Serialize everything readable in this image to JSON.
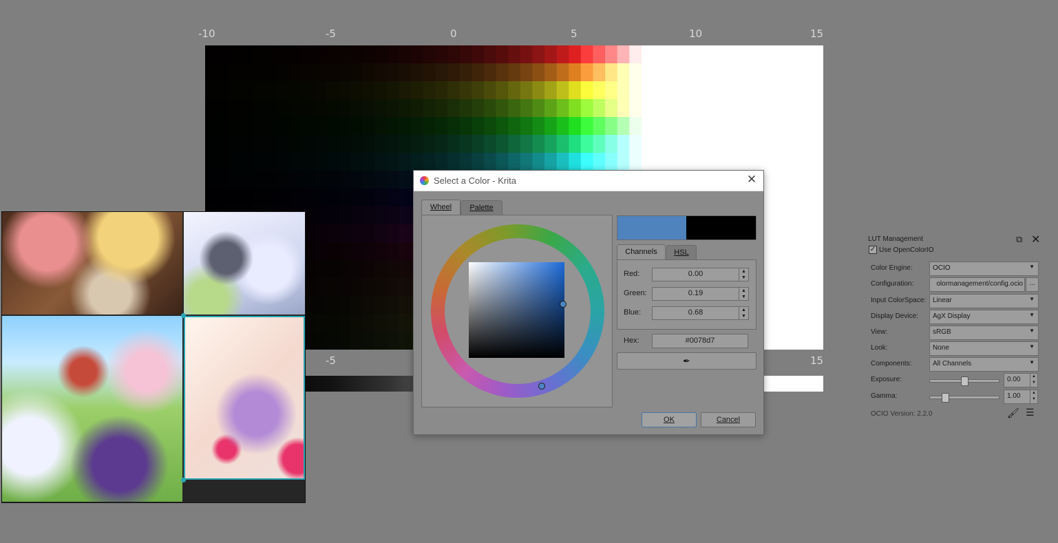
{
  "ruler_top": [
    "-10",
    "-5",
    "0",
    "5",
    "10",
    "15"
  ],
  "ruler_bottom": [
    "-5",
    "15"
  ],
  "dialog": {
    "title": "Select a Color - Krita",
    "tabs": [
      "Wheel",
      "Palette"
    ],
    "sub_tabs": [
      "Channels",
      "HSL"
    ],
    "channels": [
      {
        "label": "Red:",
        "value": "0.00"
      },
      {
        "label": "Green:",
        "value": "0.19"
      },
      {
        "label": "Blue:",
        "value": "0.68"
      }
    ],
    "hex_label": "Hex:",
    "hex_value": "#0078d7",
    "ok_label": "OK",
    "cancel_label": "Cancel",
    "new_color": "#4e83bd",
    "old_color": "#000000"
  },
  "lut": {
    "title": "LUT Management",
    "use_ocio_label": "Use OpenColorIO",
    "use_ocio_checked": "✓",
    "rows": [
      {
        "label": "Color Engine:",
        "value": "OCIO"
      },
      {
        "label": "Configuration:",
        "value": "olormanagement/config.ocio"
      },
      {
        "label": "Input ColorSpace:",
        "value": "Linear"
      },
      {
        "label": "Display Device:",
        "value": "AgX Display"
      },
      {
        "label": "View:",
        "value": "sRGB"
      },
      {
        "label": "Look:",
        "value": "None"
      },
      {
        "label": "Components:",
        "value": "All Channels"
      }
    ],
    "exposure_label": "Exposure:",
    "exposure_value": "0.00",
    "exposure_level": 0.5,
    "gamma_label": "Gamma:",
    "gamma_value": "1.00",
    "gamma_level": 0.22,
    "dots_label": "...",
    "version": "OCIO Version: 2.2.0"
  }
}
